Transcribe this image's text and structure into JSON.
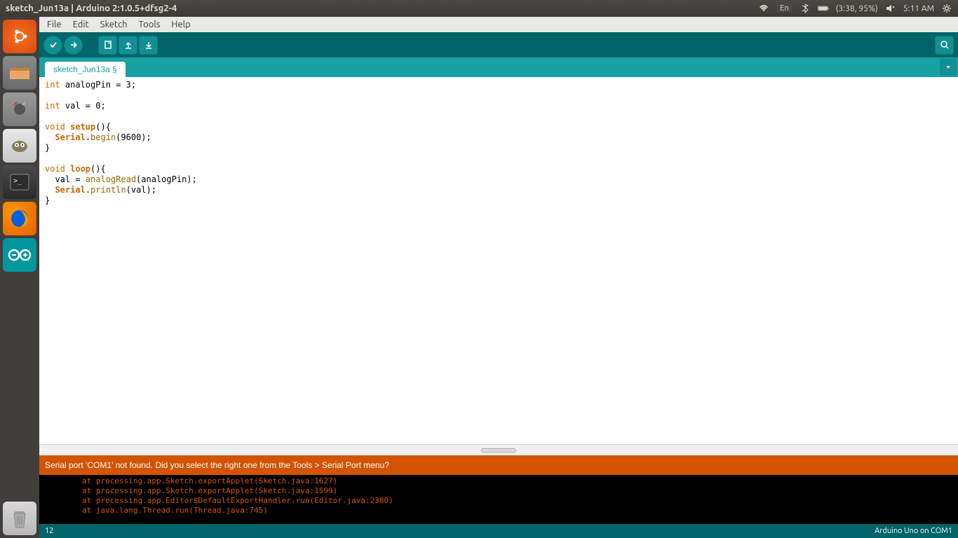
{
  "system": {
    "window_title": "sketch_Jun13a | Arduino 2:1.0.5+dfsg2-4",
    "lang": "En",
    "battery": "(3:38, 95%)",
    "time": "5:11 AM"
  },
  "menu": {
    "file": "File",
    "edit": "Edit",
    "sketch": "Sketch",
    "tools": "Tools",
    "help": "Help"
  },
  "tab": {
    "name": "sketch_Jun13a §"
  },
  "code": {
    "l1_kw": "int",
    "l1_rest": " analogPin = 3;",
    "l3_kw": "int",
    "l3_rest": " val = 0;",
    "l5_kw": "void",
    "l5_fn": " setup",
    "l5_rest": "(){",
    "l6_ind": "  ",
    "l6_obj": "Serial",
    "l6_dot": ".",
    "l6_m": "begin",
    "l6_rest": "(9600);",
    "l7": "}",
    "l9_kw": "void",
    "l9_fn": " loop",
    "l9_rest": "(){",
    "l10_ind": "  val = ",
    "l10_fn": "analogRead",
    "l10_rest": "(analogPin);",
    "l11_ind": "  ",
    "l11_obj": "Serial",
    "l11_dot": ".",
    "l11_m": "println",
    "l11_rest": "(val);",
    "l12": "}"
  },
  "status": {
    "error": "Serial port 'COM1' not found. Did you select the right one from the Tools > Serial Port menu?"
  },
  "console": {
    "l1": "        at processing.app.Sketch.exportApplet(Sketch.java:1627)",
    "l2": "        at processing.app.Sketch.exportApplet(Sketch.java:1599)",
    "l3": "        at processing.app.Editor$DefaultExportHandler.run(Editor.java:2380)",
    "l4": "        at java.lang.Thread.run(Thread.java:745)"
  },
  "bottom": {
    "line": "12",
    "board": "Arduino Uno on COM1"
  }
}
